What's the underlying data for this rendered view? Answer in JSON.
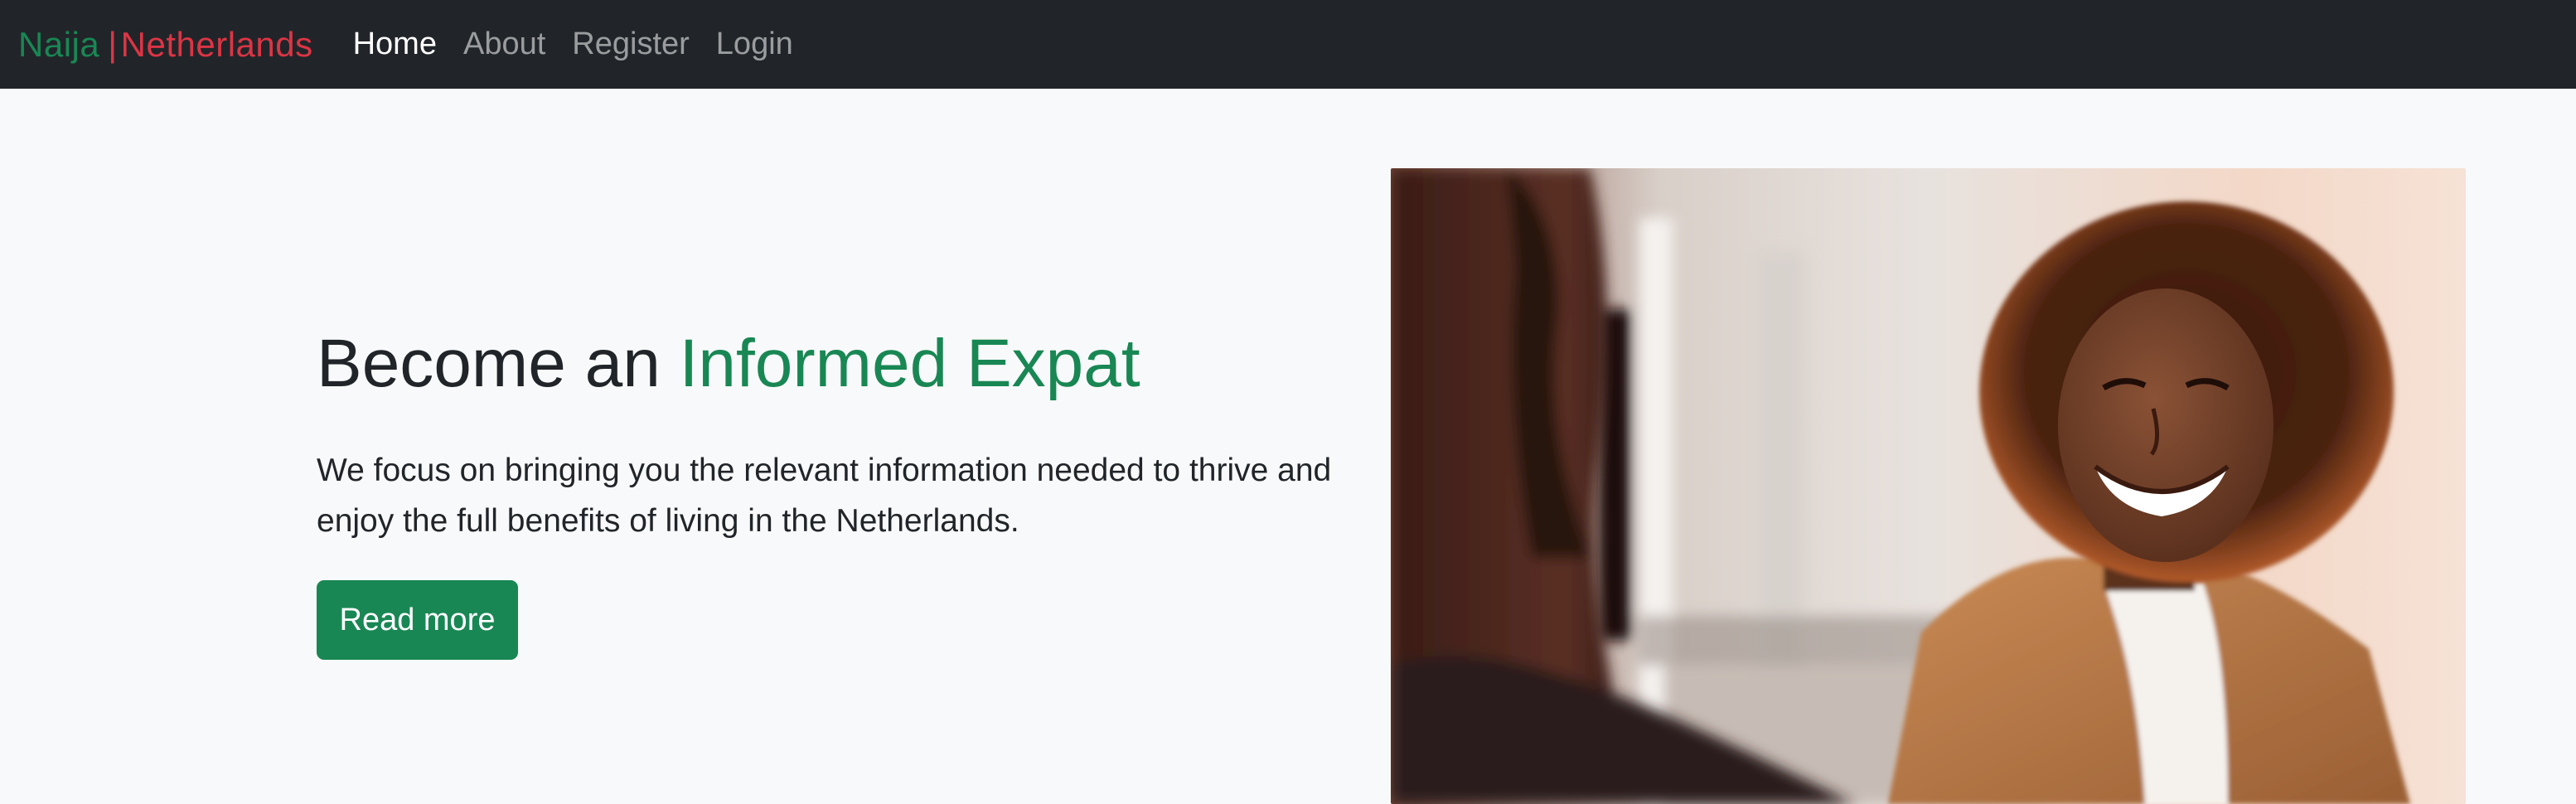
{
  "navbar": {
    "brand_part1": "Naija",
    "brand_separator": "|",
    "brand_part2": "Netherlands",
    "links": [
      {
        "label": "Home",
        "active": true
      },
      {
        "label": "About",
        "active": false
      },
      {
        "label": "Register",
        "active": false
      },
      {
        "label": "Login",
        "active": false
      }
    ]
  },
  "hero": {
    "title_prefix": "Become an ",
    "title_accent": "Informed Expat",
    "description": "We focus on bringing you the relevant information needed to thrive and enjoy the full benefits of living in the Netherlands.",
    "button_label": "Read more"
  },
  "colors": {
    "navbar_bg": "#212529",
    "brand_green": "#198754",
    "brand_red": "#dc3545",
    "button_bg": "#198754",
    "page_bg": "#f8f9fa"
  }
}
